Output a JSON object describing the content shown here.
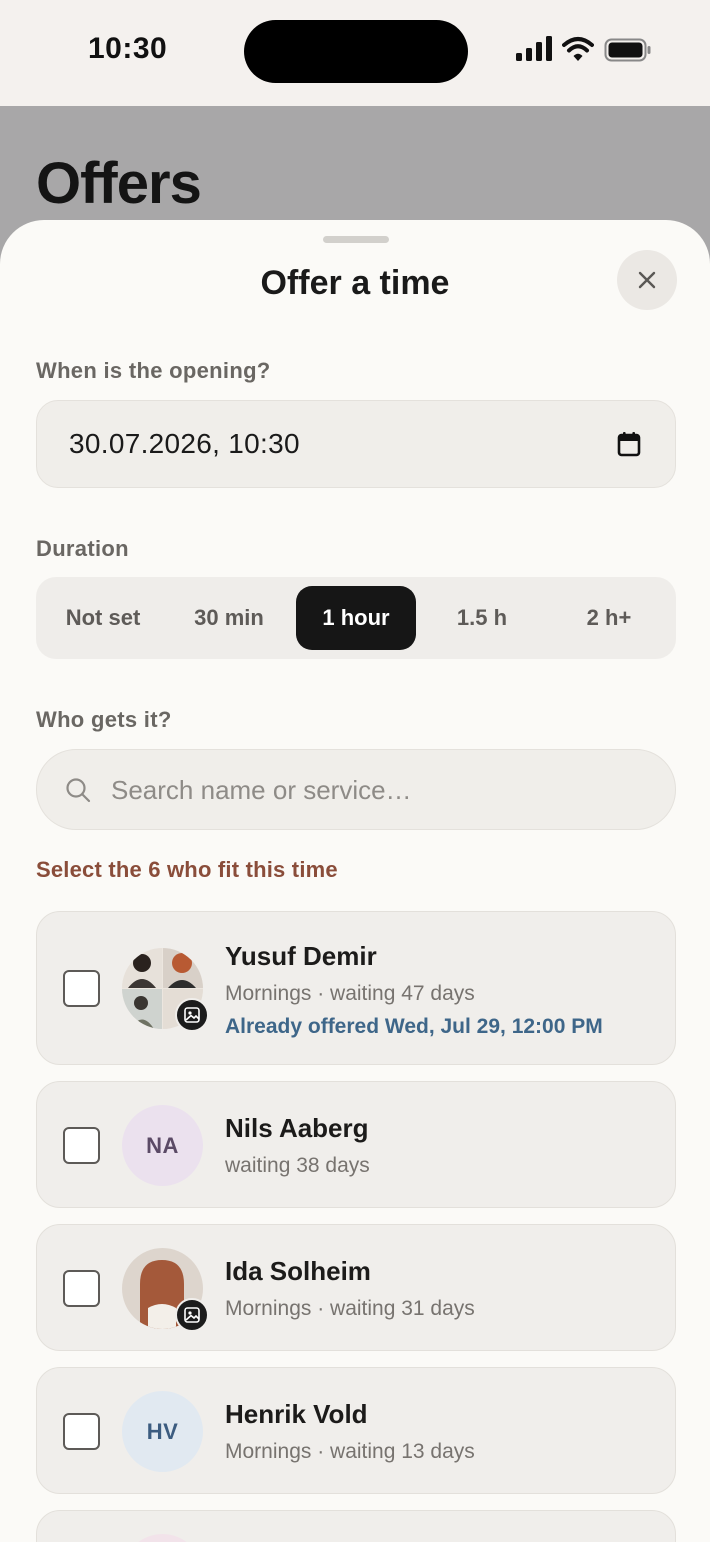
{
  "status_bar": {
    "time": "10:30"
  },
  "background_page": {
    "title": "Offers"
  },
  "sheet": {
    "title": "Offer a time",
    "close_icon": "close-icon",
    "opening_label": "When is the opening?",
    "opening_value": "30.07.2026, 10:30",
    "duration_label": "Duration",
    "duration_options": [
      "Not set",
      "30 min",
      "1 hour",
      "1.5 h",
      "2 h+"
    ],
    "duration_selected": "1 hour",
    "recipients_label": "Who gets it?",
    "search_placeholder": "Search name or service…",
    "hint": "Select the 6 who fit this time",
    "colors": {
      "accent_dark": "#161616",
      "hint": "#8a4d3a",
      "offered": "#3e6689"
    },
    "clients": [
      {
        "name": "Yusuf Demir",
        "meta": "Mornings · waiting 47 days",
        "offered": "Already offered Wed, Jul 29, 12:00 PM",
        "avatar": "photo-collage",
        "checked": false
      },
      {
        "name": "Nils Aaberg",
        "meta": "waiting 38 days",
        "initials": "NA",
        "checked": false
      },
      {
        "name": "Ida Solheim",
        "meta": "Mornings · waiting 31 days",
        "avatar": "photo",
        "checked": false
      },
      {
        "name": "Henrik Vold",
        "meta": "Mornings · waiting 13 days",
        "initials": "HV",
        "checked": false
      }
    ]
  }
}
